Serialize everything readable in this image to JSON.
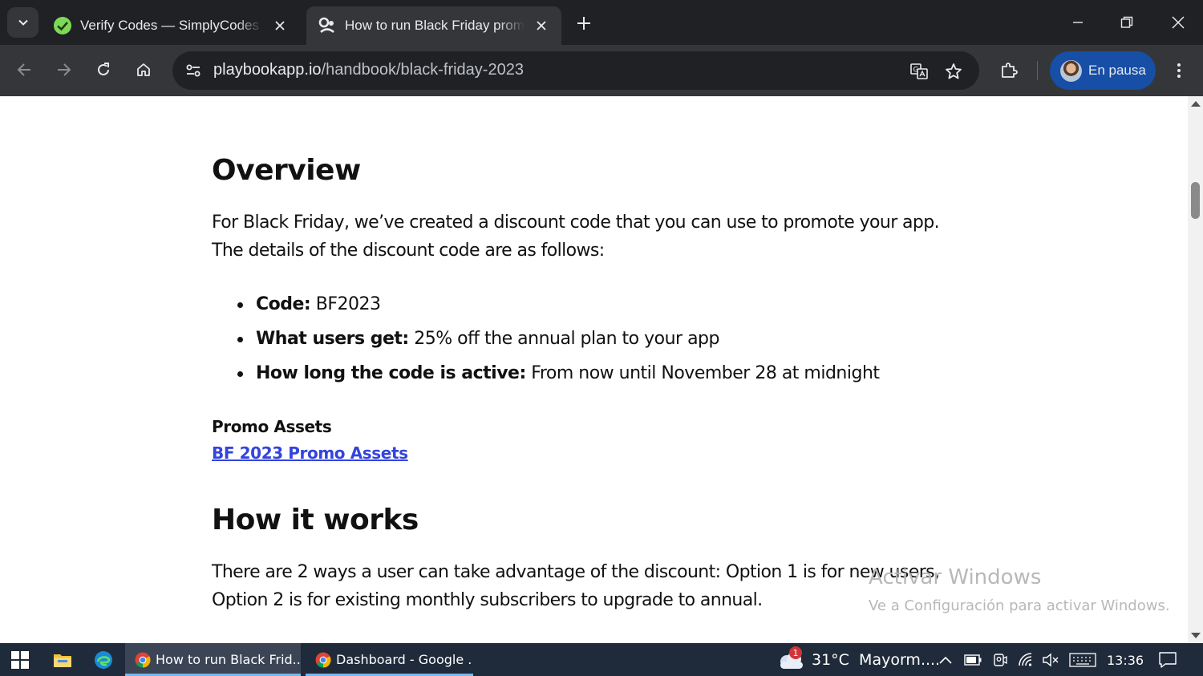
{
  "browser": {
    "tabs": [
      {
        "title": "Verify Codes — SimplyCodes",
        "favicon": "simplycodes-check-icon",
        "active": false
      },
      {
        "title": "How to run Black Friday promos",
        "favicon": "playbook-logo-icon",
        "active": true
      }
    ],
    "address": {
      "host": "playbookapp.io",
      "path": "/handbook/black-friday-2023"
    },
    "profile_label": "En pausa",
    "accent_color": "#174ea6"
  },
  "page": {
    "overview_heading": "Overview",
    "overview_text": "For Black Friday, we’ve created a discount code that you can use to promote your app. The details of the discount code are as follows:",
    "details": [
      {
        "label": "Code:",
        "value": " BF2023"
      },
      {
        "label": "What users get:",
        "value": " 25% off the annual plan to your app"
      },
      {
        "label": "How long the code is active:",
        "value": " From now until November 28 at midnight"
      }
    ],
    "assets_label": "Promo Assets",
    "assets_link": "BF 2023 Promo Assets",
    "link_color": "#3344dd",
    "how_heading": "How it works",
    "how_text": "There are 2 ways a user can take advantage of the discount: Option 1 is for new users, Option 2 is for existing monthly subscribers to upgrade to annual."
  },
  "watermark": {
    "line1": "Activar Windows",
    "line2": "Ve a Configuración para activar Windows."
  },
  "taskbar": {
    "apps": [
      {
        "label": "How to run Black Frid...",
        "active": true
      },
      {
        "label": "Dashboard - Google ...",
        "active": false
      }
    ],
    "weather": {
      "temp": "31°C",
      "desc": "Mayorm....",
      "badge": "1"
    },
    "time": "13:36"
  }
}
